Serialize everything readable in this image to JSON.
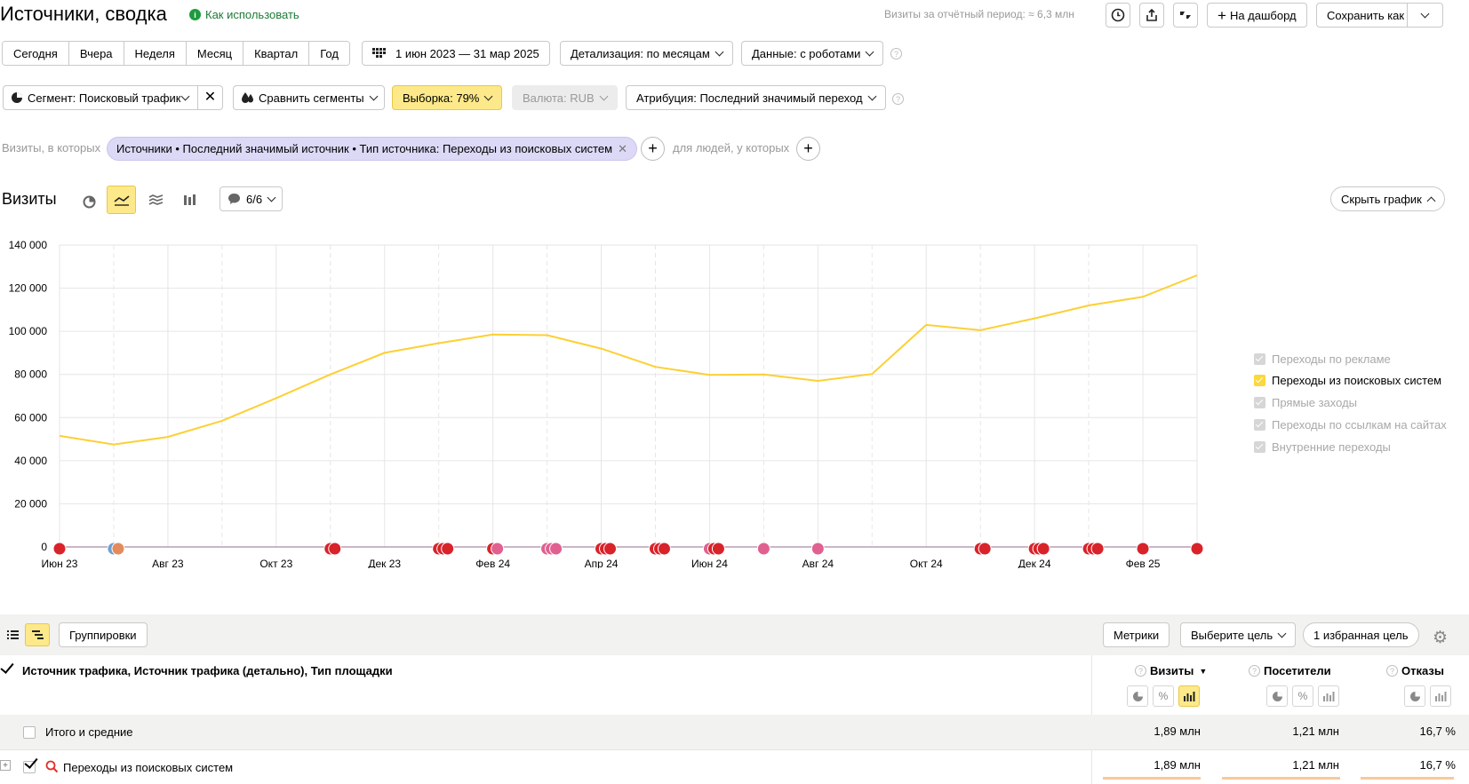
{
  "header": {
    "title": "Источники, сводка",
    "how_to_use": "Как использовать",
    "visits_period": "Визиты за отчётный период: ≈ 6,3 млн",
    "to_dashboard": "На дашборд",
    "save_as": "Сохранить как"
  },
  "periods": [
    "Сегодня",
    "Вчера",
    "Неделя",
    "Месяц",
    "Квартал",
    "Год"
  ],
  "date_range": "1 июн 2023 — 31 мар 2025",
  "detail": "Детализация: по месяцам",
  "data_mode": "Данные: с роботами",
  "segment": "Сегмент: Поисковый трафик",
  "compare": "Сравнить сегменты",
  "sample": "Выборка: 79%",
  "currency": "Валюта: RUB",
  "attribution": "Атрибуция: Последний значимый переход",
  "filter": {
    "visits_where": "Визиты, в которых",
    "chip": "Источники • Последний значимый источник • Тип источника: Переходы из поисковых систем",
    "people_where": "для людей, у которых"
  },
  "chart_section": {
    "title": "Визиты",
    "notes": "6/6",
    "hide_chart": "Скрыть график"
  },
  "chart_data": {
    "type": "line",
    "x": [
      "Июн 23",
      "Июл 23",
      "Авг 23",
      "Сен 23",
      "Окт 23",
      "Ноя 23",
      "Дек 23",
      "Янв 24",
      "Фев 24",
      "Мар 24",
      "Апр 24",
      "Май 24",
      "Июн 24",
      "Июл 24",
      "Авг 24",
      "Сен 24",
      "Окт 24",
      "Ноя 24",
      "Дек 24",
      "Янв 25",
      "Фев 25",
      "Мар 25"
    ],
    "x_tick_labels": [
      "Июн 23",
      "Авг 23",
      "Окт 23",
      "Дек 23",
      "Фев 24",
      "Апр 24",
      "Июн 24",
      "Авг 24",
      "Окт 24",
      "Дек 24",
      "Фев 25"
    ],
    "series": [
      {
        "name": "Переходы из поисковых систем",
        "color": "#fcd034",
        "values": [
          51500,
          47500,
          51000,
          58500,
          69000,
          80000,
          90000,
          94500,
          98500,
          98200,
          92000,
          83500,
          79800,
          80000,
          77000,
          80200,
          103000,
          100500,
          106000,
          112000,
          116000,
          126000
        ]
      }
    ],
    "ylim": [
      0,
      140000
    ],
    "y_ticks": [
      "0",
      "20 000",
      "40 000",
      "60 000",
      "80 000",
      "100 000",
      "120 000",
      "140 000"
    ],
    "grid": true,
    "legend_position": "right"
  },
  "legend": [
    {
      "label": "Переходы по рекламе",
      "on": false
    },
    {
      "label": "Переходы из поисковых систем",
      "on": true
    },
    {
      "label": "Прямые заходы",
      "on": false
    },
    {
      "label": "Переходы по ссылкам на сайтах",
      "on": false
    },
    {
      "label": "Внутренние переходы",
      "on": false
    }
  ],
  "table": {
    "groupings": "Группировки",
    "metrics": "Метрики",
    "choose_goal": "Выберите цель",
    "fav_goal": "1 избранная цель",
    "dimension_header": "Источник трафика, Источник трафика (детально), Тип площадки",
    "columns": [
      "Визиты",
      "Посетители",
      "Отказы"
    ],
    "visits_sort": "▼",
    "total": {
      "label": "Итого и средние",
      "values": [
        "1,89 млн",
        "1,21 млн",
        "16,7 %"
      ]
    },
    "rows": [
      {
        "label": "Переходы из поисковых систем",
        "values": [
          "1,89 млн",
          "1,21 млн",
          "16,7 %"
        ]
      }
    ]
  }
}
